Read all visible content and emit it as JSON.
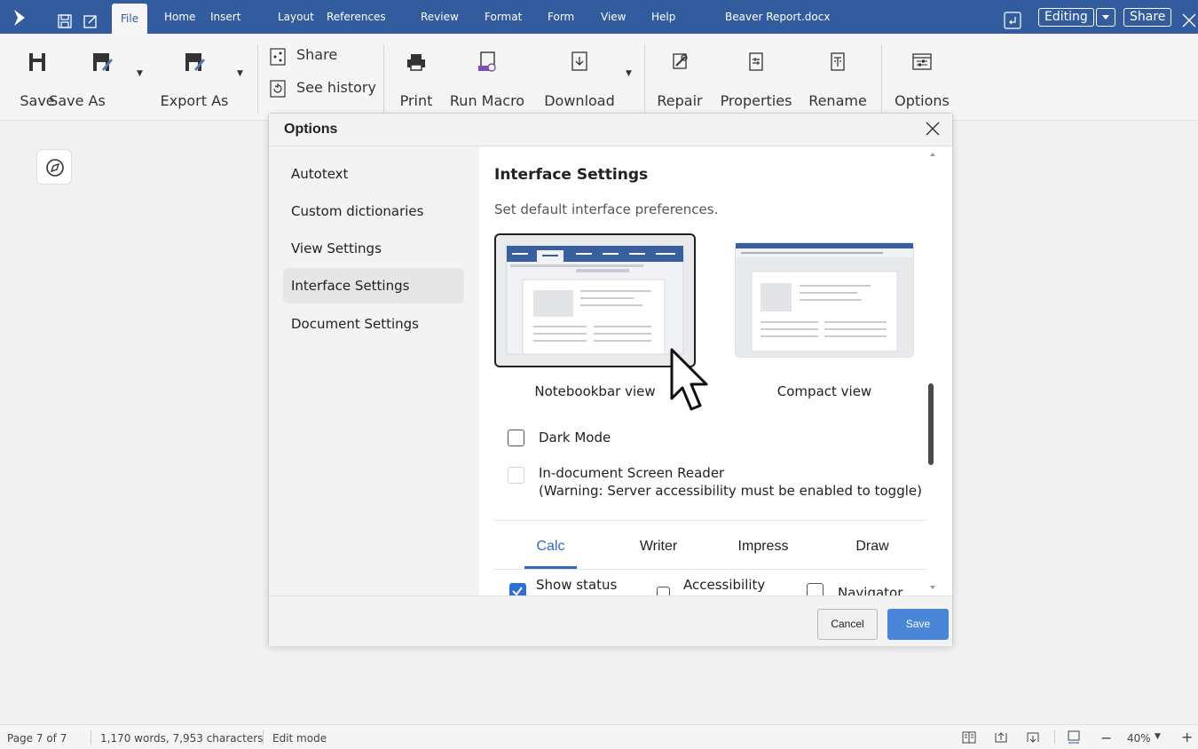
{
  "topbar": {
    "tabs": [
      "File",
      "Home",
      "Insert",
      "Layout",
      "References",
      "Review",
      "Format",
      "Form",
      "View",
      "Help"
    ],
    "document_name": "Beaver Report.docx",
    "editing_label": "Editing",
    "share_label": "Share",
    "accent": "#325c9e"
  },
  "ribbon": {
    "save": "Save",
    "save_as": "Save As",
    "export_as": "Export As",
    "share": "Share",
    "see_history": "See history",
    "print": "Print",
    "run_macro": "Run Macro",
    "download": "Download",
    "repair": "Repair",
    "properties": "Properties",
    "rename": "Rename",
    "options": "Options"
  },
  "dialog": {
    "title": "Options",
    "sidebar": [
      "Autotext",
      "Custom dictionaries",
      "View Settings",
      "Interface Settings",
      "Document Settings"
    ],
    "active_index": 3,
    "heading": "Interface Settings",
    "subheading": "Set default interface preferences.",
    "views": [
      {
        "label": "Notebookbar view",
        "selected": true
      },
      {
        "label": "Compact view",
        "selected": false
      }
    ],
    "dark_mode_label": "Dark Mode",
    "screen_reader_label": "In-document Screen Reader",
    "screen_reader_warning": "(Warning: Server accessibility must be enabled to toggle)",
    "app_tabs": [
      "Calc",
      "Writer",
      "Impress",
      "Draw"
    ],
    "active_app_tab": "Calc",
    "options": [
      {
        "label": "Show status",
        "checked": true
      },
      {
        "label": "Accessibility",
        "checked": false
      },
      {
        "label": "Navigator",
        "checked": false
      }
    ],
    "cancel_label": "Cancel",
    "save_label": "Save",
    "primary_color": "#4a86d8"
  },
  "status": {
    "page": "Page 7 of 7",
    "counts": "1,170 words, 7,953 characters",
    "mode": "Edit mode",
    "zoom": "40%"
  }
}
